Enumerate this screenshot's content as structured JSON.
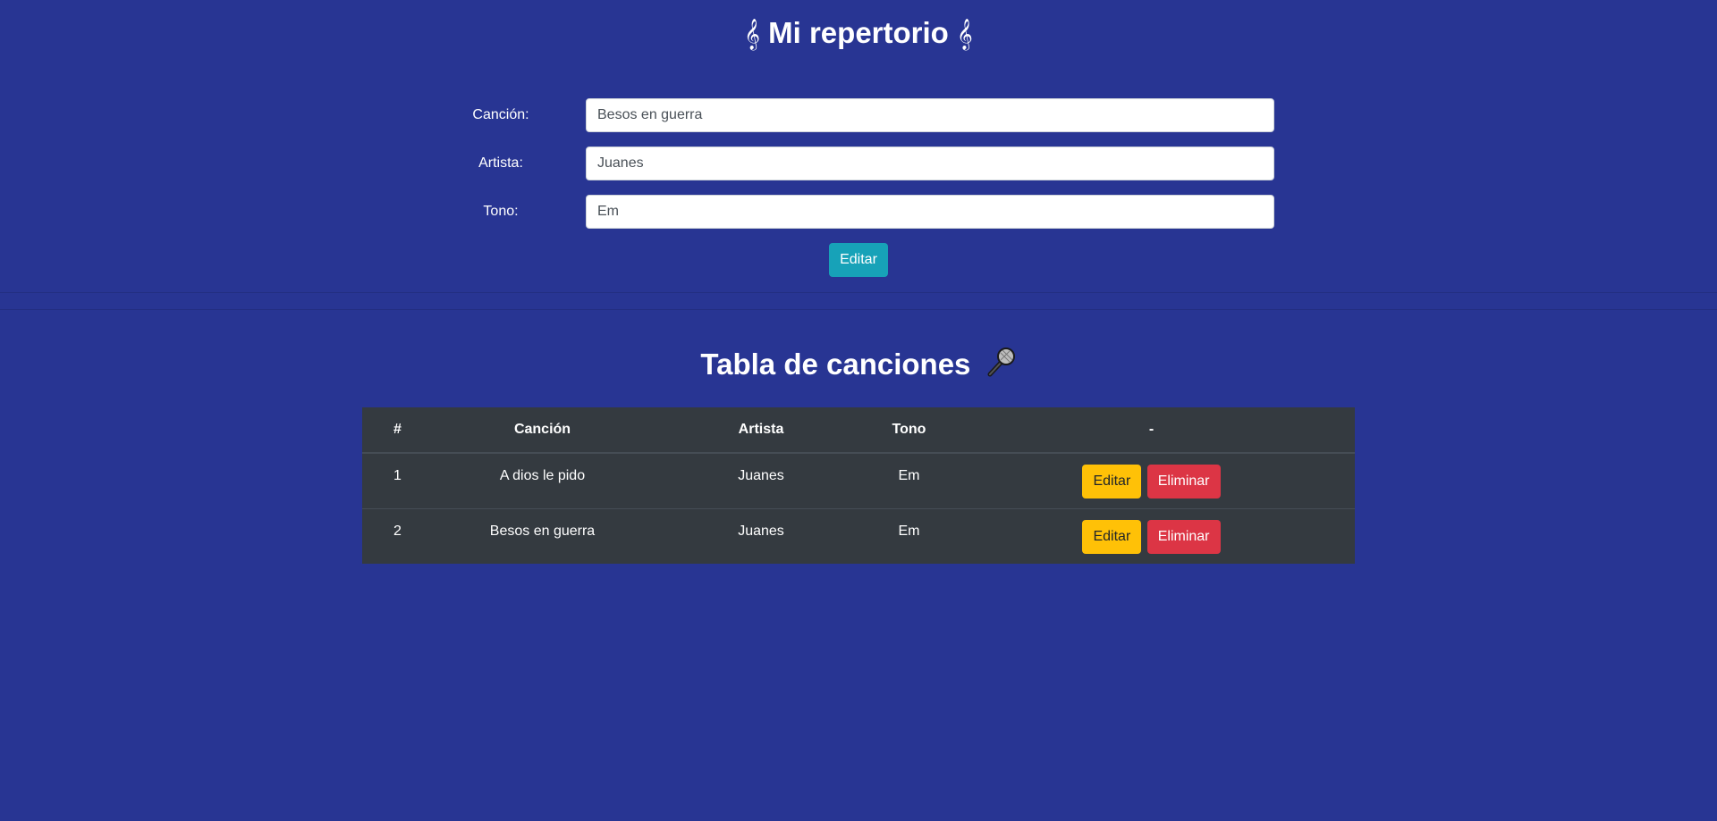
{
  "header": {
    "title": "Mi repertorio",
    "clef_left": "𝄞",
    "clef_right": "𝄞"
  },
  "form": {
    "song_label": "Canción:",
    "song_value": "Besos en guerra",
    "artist_label": "Artista:",
    "artist_value": "Juanes",
    "key_label": "Tono:",
    "key_value": "Em",
    "submit_label": "Editar"
  },
  "table": {
    "title": "Tabla de canciones",
    "title_icon": "microphone-icon",
    "columns": [
      "#",
      "Canción",
      "Artista",
      "Tono",
      "-"
    ],
    "rows": [
      {
        "num": "1",
        "song": "A dios le pido",
        "artist": "Juanes",
        "key": "Em",
        "edit_label": "Editar",
        "delete_label": "Eliminar"
      },
      {
        "num": "2",
        "song": "Besos en guerra",
        "artist": "Juanes",
        "key": "Em",
        "edit_label": "Editar",
        "delete_label": "Eliminar"
      }
    ]
  },
  "colors": {
    "background": "#283593",
    "table_bg": "#343a40",
    "info_button": "#17a2b8",
    "warning_button": "#ffc107",
    "danger_button": "#dc3545"
  }
}
